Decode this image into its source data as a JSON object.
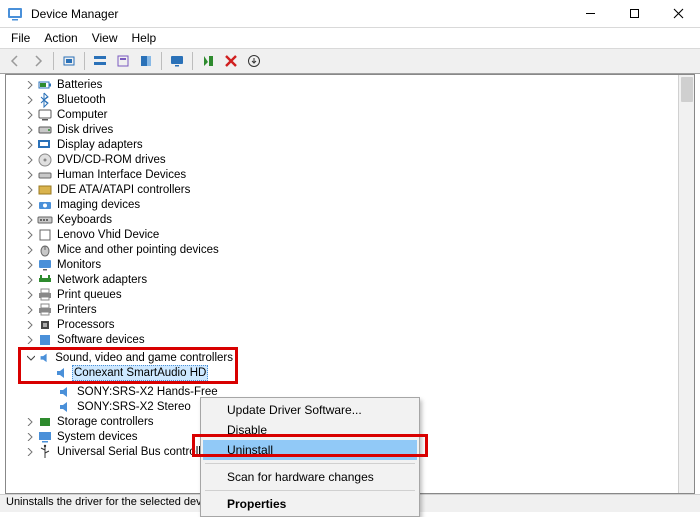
{
  "titlebar": {
    "title": "Device Manager"
  },
  "menu": {
    "file": "File",
    "action": "Action",
    "view": "View",
    "help": "Help"
  },
  "toolbar": {
    "back": "Back",
    "fwd": "Forward",
    "up": "Up",
    "show": "Show hidden",
    "properties": "Properties",
    "help": "Help",
    "scan": "Scan",
    "enable": "Enable",
    "uninstall": "Uninstall",
    "update": "Update"
  },
  "tree": {
    "items": [
      {
        "label": "Batteries"
      },
      {
        "label": "Bluetooth"
      },
      {
        "label": "Computer"
      },
      {
        "label": "Disk drives"
      },
      {
        "label": "Display adapters"
      },
      {
        "label": "DVD/CD-ROM drives"
      },
      {
        "label": "Human Interface Devices"
      },
      {
        "label": "IDE ATA/ATAPI controllers"
      },
      {
        "label": "Imaging devices"
      },
      {
        "label": "Keyboards"
      },
      {
        "label": "Lenovo Vhid Device"
      },
      {
        "label": "Mice and other pointing devices"
      },
      {
        "label": "Monitors"
      },
      {
        "label": "Network adapters"
      },
      {
        "label": "Print queues"
      },
      {
        "label": "Printers"
      },
      {
        "label": "Processors"
      },
      {
        "label": "Software devices"
      },
      {
        "label": "Sound, video and game controllers",
        "children": [
          {
            "label": "Conexant SmartAudio HD"
          },
          {
            "label": "SONY:SRS-X2 Hands-Free"
          },
          {
            "label": "SONY:SRS-X2 Stereo"
          }
        ]
      },
      {
        "label": "Storage controllers"
      },
      {
        "label": "System devices"
      },
      {
        "label": "Universal Serial Bus controllers"
      }
    ]
  },
  "context_menu": {
    "update": "Update Driver Software...",
    "disable": "Disable",
    "uninstall": "Uninstall",
    "scan": "Scan for hardware changes",
    "properties": "Properties"
  },
  "statusbar": {
    "text": "Uninstalls the driver for the selected device."
  }
}
